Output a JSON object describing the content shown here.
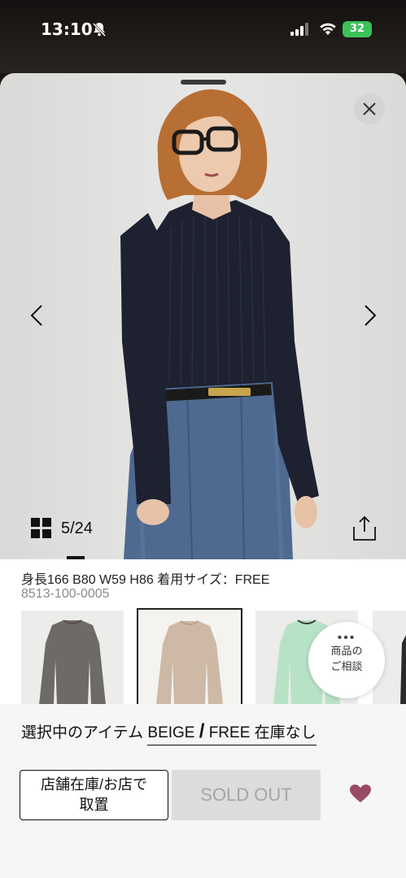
{
  "status_bar": {
    "time": "13:10",
    "battery": "32"
  },
  "product": {
    "image_counter": "5/24",
    "size_info": "身長166 B80 W59 H86 着用サイズ：FREE",
    "product_code": "8513-100-0005"
  },
  "consult": {
    "dots": "•••",
    "line1": "商品の",
    "line2": "ご相談"
  },
  "selection": {
    "prefix": "選択中のアイテム",
    "color": "BEIGE",
    "separator": "/",
    "size": "FREE",
    "stock": "在庫なし"
  },
  "actions": {
    "store_line1": "店舗在庫/お店で",
    "store_line2": "取置",
    "sold_out": "SOLD OUT"
  },
  "colors": {
    "accent_heart": "#9a4a66",
    "top_navy": "#1d2130",
    "thumb_gray": "#6e6a66",
    "thumb_beige": "#cdb9a6",
    "thumb_mint": "#b8e2c6"
  }
}
